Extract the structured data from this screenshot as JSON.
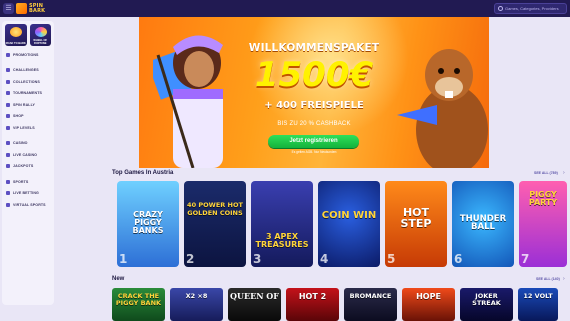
{
  "header": {
    "menu_icon": "hamburger-icon",
    "logo_text": "SPIN\nBARK",
    "search": {
      "placeholder": "Games, Categories, Providers",
      "icon": "search-icon"
    }
  },
  "sidebar": {
    "cards": [
      {
        "label": "ROAD TO BARK",
        "color": "#ffcf3d"
      },
      {
        "label": "WHEEL OF FORTUNE",
        "color": "#ff5fa8"
      }
    ],
    "items": [
      {
        "label": "PROMOTIONS",
        "icon": "gift-icon"
      },
      {
        "label": "CHALLENGES",
        "icon": "trophy-icon"
      },
      {
        "label": "COLLECTIONS",
        "icon": "collection-icon"
      },
      {
        "label": "TOURNAMENTS",
        "icon": "tournament-icon"
      },
      {
        "label": "SPIN RALLY",
        "icon": "rally-icon"
      },
      {
        "label": "SHOP",
        "icon": "shop-icon"
      },
      {
        "label": "VIP LEVELS",
        "icon": "vip-icon"
      },
      {
        "label": "CASINO",
        "icon": "casino-icon"
      },
      {
        "label": "LIVE CASINO",
        "icon": "live-casino-icon"
      },
      {
        "label": "JACKPOTS",
        "icon": "jackpot-icon"
      },
      {
        "label": "SPORTS",
        "icon": "sports-icon"
      },
      {
        "label": "LIVE BETTING",
        "icon": "live-betting-icon"
      },
      {
        "label": "VIRTUAL SPORTS",
        "icon": "virtual-sports-icon"
      }
    ]
  },
  "hero": {
    "title": "WILLKOMMENSPAKET",
    "amount": "1500€",
    "spins": "+ 400 FREISPIELE",
    "cashback": "BIS ZU 20 % CASHBACK",
    "button": "Jetzt registrieren",
    "subtext": "Es gelten AGB. Nur Neukunden"
  },
  "top_games": {
    "title": "Top Games In Austria",
    "see_all": "SEE ALL (789)",
    "games": [
      {
        "title": "CRAZY PIGGY BANKS",
        "rank": "1",
        "color_a": "#6fd0ff",
        "color_b": "#2d6fd6"
      },
      {
        "title": "40 POWER HOT GOLDEN COINS",
        "rank": "2",
        "color_a": "#1b2b6b",
        "color_b": "#0c1440"
      },
      {
        "title": "3 APEX TREASURES",
        "rank": "3",
        "color_a": "#3a3fb0",
        "color_b": "#141a5c"
      },
      {
        "title": "COIN WIN",
        "rank": "4",
        "color_a": "#1a3fb8",
        "color_b": "#0b1a66"
      },
      {
        "title": "HOT STEP",
        "rank": "5",
        "color_a": "#ff8a1a",
        "color_b": "#c63a05"
      },
      {
        "title": "THUNDER BALL",
        "rank": "6",
        "color_a": "#3bb8ff",
        "color_b": "#1356b8"
      },
      {
        "title": "PIGGY PARTY",
        "rank": "7",
        "color_a": "#ff5fb0",
        "color_b": "#9b2fd6"
      }
    ]
  },
  "new_games": {
    "title": "New",
    "see_all": "SEE ALL (140)",
    "games": [
      {
        "title": "CRACK THE PIGGY BANK",
        "color_a": "#2a8b3a",
        "color_b": "#0f4a1c"
      },
      {
        "title": "X2 ×8",
        "color_a": "#3a47a8",
        "color_b": "#161c5a"
      },
      {
        "title": "QUEEN OF",
        "color_a": "#2b2b2b",
        "color_b": "#0a0a0a"
      },
      {
        "title": "HOT 2",
        "color_a": "#c4121a",
        "color_b": "#5a0508"
      },
      {
        "title": "BROMANCE",
        "color_a": "#2a2a4a",
        "color_b": "#0c0c20"
      },
      {
        "title": "HOPE",
        "color_a": "#f04a1a",
        "color_b": "#6a1206"
      },
      {
        "title": "JOKER STREAK",
        "color_a": "#1a1a6a",
        "color_b": "#06062a"
      },
      {
        "title": "12 VOLT",
        "color_a": "#1a4ab8",
        "color_b": "#08185a"
      }
    ]
  }
}
